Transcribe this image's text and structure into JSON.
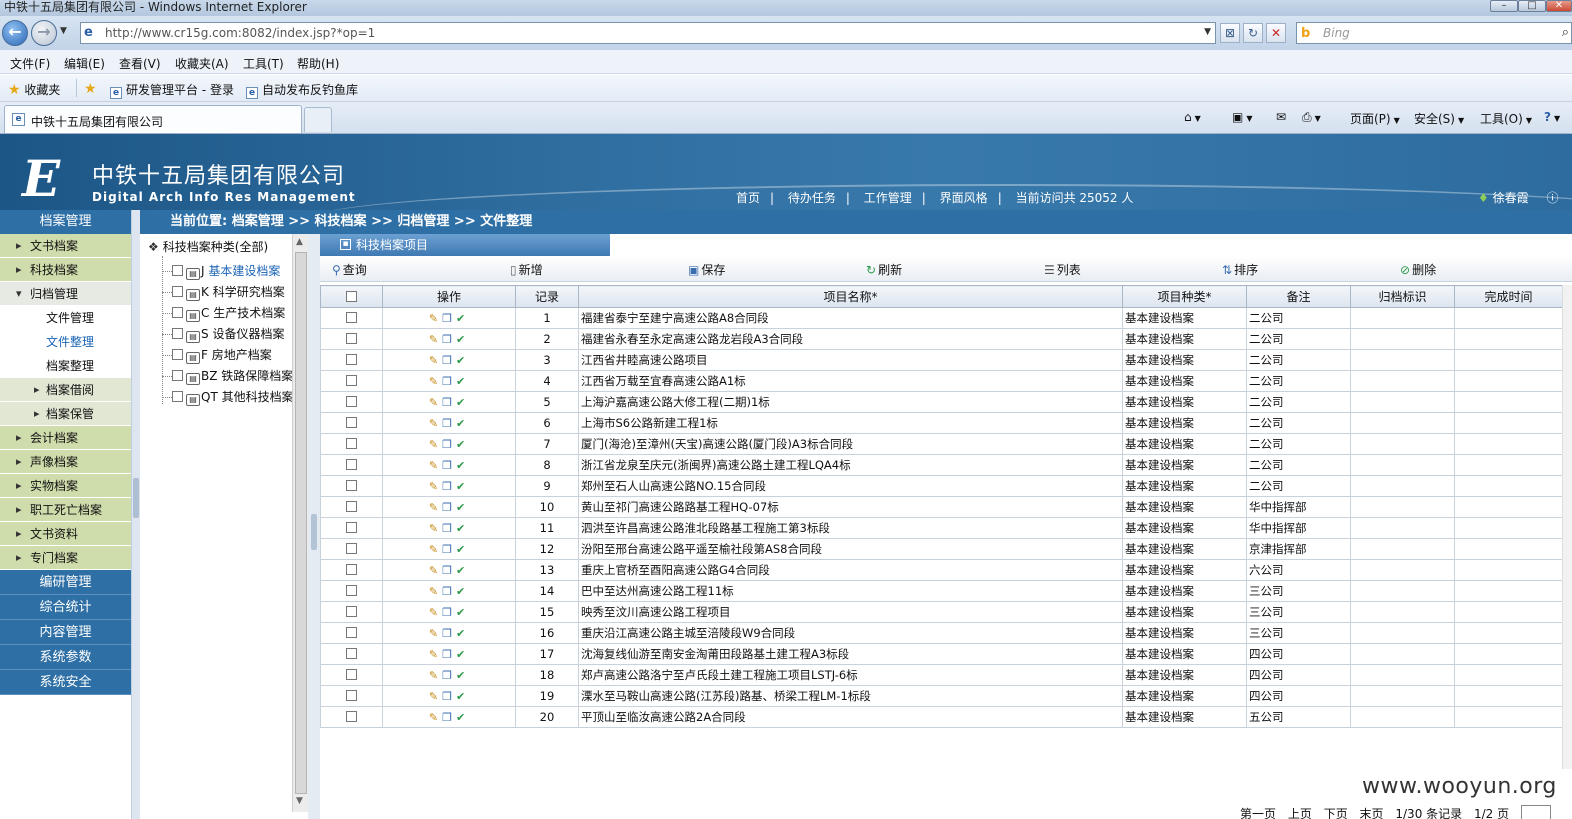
{
  "browser": {
    "window_title": "中铁十五局集团有限公司 - Windows Internet Explorer",
    "url": "http://www.cr15g.com:8082/index.jsp?*op=1",
    "search_placeholder": "Bing",
    "menu": [
      "文件(F)",
      "编辑(E)",
      "查看(V)",
      "收藏夹(A)",
      "工具(T)",
      "帮助(H)"
    ],
    "favorites_label": "收藏夹",
    "favorites": [
      "研发管理平台 - 登录",
      "自动发布反钓鱼库"
    ],
    "tab_title": "中铁十五局集团有限公司",
    "commands": [
      "页面(P)",
      "安全(S)",
      "工具(O)"
    ]
  },
  "header": {
    "logo_letter": "E",
    "company_name": "中铁十五局集团有限公司",
    "english_name": "Digital Arch Info Res Management",
    "nav": [
      "首页",
      "待办任务",
      "工作管理",
      "界面风格"
    ],
    "visits_text": "当前访问共 25052 人",
    "user_name": "徐春霞"
  },
  "sidebar": {
    "top": "档案管理",
    "items": [
      {
        "label": "文书档案",
        "type": "grp"
      },
      {
        "label": "科技档案",
        "type": "grp"
      },
      {
        "label": "归档管理",
        "type": "grp-open"
      },
      {
        "label": "文件管理",
        "type": "sub"
      },
      {
        "label": "文件整理",
        "type": "sub-active"
      },
      {
        "label": "档案整理",
        "type": "sub"
      },
      {
        "label": "档案借阅",
        "type": "subgrp"
      },
      {
        "label": "档案保管",
        "type": "subgrp"
      },
      {
        "label": "会计档案",
        "type": "grp"
      },
      {
        "label": "声像档案",
        "type": "grp"
      },
      {
        "label": "实物档案",
        "type": "grp"
      },
      {
        "label": "职工死亡档案",
        "type": "grp"
      },
      {
        "label": "文书资料",
        "type": "grp"
      },
      {
        "label": "专门档案",
        "type": "grp"
      }
    ],
    "bottom": [
      "编研管理",
      "综合统计",
      "内容管理",
      "系统参数",
      "系统安全"
    ]
  },
  "breadcrumb": "当前位置: 档案管理 >> 科技档案 >> 归档管理 >> 文件整理",
  "tree": {
    "root": "科技档案种类(全部)",
    "nodes": [
      {
        "code": "J",
        "label": "基本建设档案",
        "active": true
      },
      {
        "code": "K",
        "label": "科学研究档案"
      },
      {
        "code": "C",
        "label": "生产技术档案"
      },
      {
        "code": "S",
        "label": "设备仪器档案"
      },
      {
        "code": "F",
        "label": "房地产档案"
      },
      {
        "code": "BZ",
        "label": "铁路保障档案"
      },
      {
        "code": "QT",
        "label": "其他科技档案"
      }
    ]
  },
  "panel": {
    "title": "科技档案项目",
    "toolbar": [
      "查询",
      "新增",
      "保存",
      "刷新",
      "列表",
      "排序",
      "删除"
    ],
    "columns": [
      "操作",
      "记录",
      "项目名称*",
      "项目种类*",
      "备注",
      "归档标识",
      "完成时间"
    ],
    "rows": [
      {
        "no": "1",
        "name": "福建省泰宁至建宁高速公路A8合同段",
        "kind": "基本建设档案",
        "note": "二公司"
      },
      {
        "no": "2",
        "name": "福建省永春至永定高速公路龙岩段A3合同段",
        "kind": "基本建设档案",
        "note": "二公司"
      },
      {
        "no": "3",
        "name": "江西省井睦高速公路项目",
        "kind": "基本建设档案",
        "note": "二公司"
      },
      {
        "no": "4",
        "name": "江西省万载至宜春高速公路A1标",
        "kind": "基本建设档案",
        "note": "二公司"
      },
      {
        "no": "5",
        "name": "上海沪嘉高速公路大修工程(二期)1标",
        "kind": "基本建设档案",
        "note": "二公司"
      },
      {
        "no": "6",
        "name": "上海市S6公路新建工程1标",
        "kind": "基本建设档案",
        "note": "二公司"
      },
      {
        "no": "7",
        "name": "厦门(海沧)至漳州(天宝)高速公路(厦门段)A3标合同段",
        "kind": "基本建设档案",
        "note": "二公司"
      },
      {
        "no": "8",
        "name": "浙江省龙泉至庆元(浙闽界)高速公路土建工程LQA4标",
        "kind": "基本建设档案",
        "note": "二公司"
      },
      {
        "no": "9",
        "name": "郑州至石人山高速公路NO.15合同段",
        "kind": "基本建设档案",
        "note": "二公司"
      },
      {
        "no": "10",
        "name": "黄山至祁门高速公路路基工程HQ-07标",
        "kind": "基本建设档案",
        "note": "华中指挥部"
      },
      {
        "no": "11",
        "name": "泗洪至许昌高速公路淮北段路基工程施工第3标段",
        "kind": "基本建设档案",
        "note": "华中指挥部"
      },
      {
        "no": "12",
        "name": "汾阳至邢台高速公路平遥至榆社段第AS8合同段",
        "kind": "基本建设档案",
        "note": "京津指挥部"
      },
      {
        "no": "13",
        "name": "重庆上官桥至酉阳高速公路G4合同段",
        "kind": "基本建设档案",
        "note": "六公司"
      },
      {
        "no": "14",
        "name": "巴中至达州高速公路工程11标",
        "kind": "基本建设档案",
        "note": "三公司"
      },
      {
        "no": "15",
        "name": "映秀至汶川高速公路工程项目",
        "kind": "基本建设档案",
        "note": "三公司"
      },
      {
        "no": "16",
        "name": "重庆沿江高速公路主城至涪陵段W9合同段",
        "kind": "基本建设档案",
        "note": "三公司"
      },
      {
        "no": "17",
        "name": "沈海复线仙游至南安金淘莆田段路基土建工程A3标段",
        "kind": "基本建设档案",
        "note": "四公司"
      },
      {
        "no": "18",
        "name": "郑卢高速公路洛宁至卢氏段土建工程施工项目LSTJ-6标",
        "kind": "基本建设档案",
        "note": "四公司"
      },
      {
        "no": "19",
        "name": "溧水至马鞍山高速公路(江苏段)路基、桥梁工程LM-1标段",
        "kind": "基本建设档案",
        "note": "四公司"
      },
      {
        "no": "20",
        "name": "平顶山至临汝高速公路2A合同段",
        "kind": "基本建设档案",
        "note": "五公司"
      }
    ],
    "pager": [
      "第一页",
      "上页",
      "下页",
      "末页",
      "1/30 条记录",
      "1/2 页"
    ]
  },
  "watermark": "www.wooyun.org",
  "colors": {
    "brand_blue": "#2e6fa5",
    "sidebar_green": "#cfdcab"
  }
}
